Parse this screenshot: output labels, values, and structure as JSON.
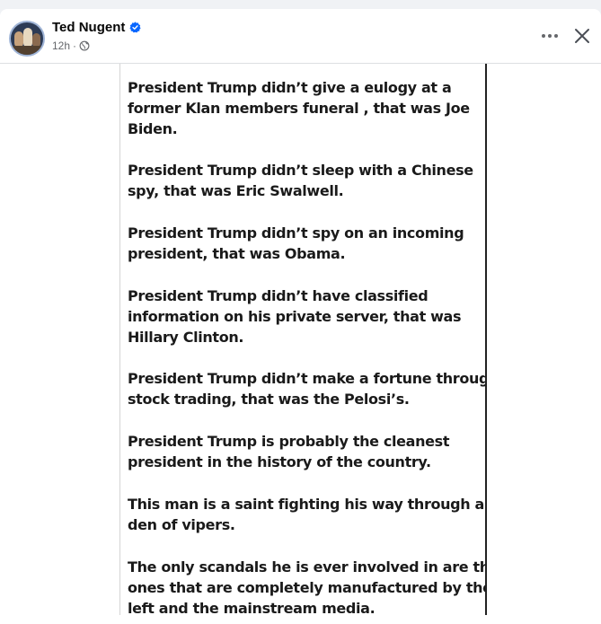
{
  "post": {
    "author": "Ted Nugent",
    "time": "12h",
    "separator": "·"
  },
  "image_text": {
    "paragraphs": [
      {
        "lines": [
          "President Trump didn’t give a eulogy at a",
          "former Klan members funeral , that was Joe",
          "Biden."
        ]
      },
      {
        "lines": [
          "President Trump didn’t sleep with a Chinese",
          "spy, that was Eric Swalwell."
        ]
      },
      {
        "lines": [
          "President Trump didn’t spy on an incoming",
          "president, that was Obama."
        ]
      },
      {
        "lines": [
          "President Trump didn’t have classified",
          "information on his private server, that was",
          "Hillary Clinton."
        ]
      },
      {
        "lines": [
          "President Trump didn’t make a fortune through",
          "stock trading, that was the Pelosi’s."
        ]
      },
      {
        "lines": [
          "President Trump is probably the cleanest",
          "president in the history of the country."
        ]
      },
      {
        "lines": [
          "This man is a saint fighting his way through a",
          "den of vipers."
        ]
      },
      {
        "lines": [
          "The only scandals he is ever involved in are the",
          "ones that are completely manufactured by the",
          "left and the mainstream media."
        ]
      }
    ]
  },
  "icons": {
    "verified": "verified-badge-icon",
    "privacy": "globe-icon",
    "more": "more-options-icon",
    "close": "close-icon"
  },
  "colors": {
    "background": "#f0f2f5",
    "card": "#ffffff",
    "primary_text": "#050505",
    "secondary_text": "#65676b",
    "verified_blue": "#0866ff"
  }
}
